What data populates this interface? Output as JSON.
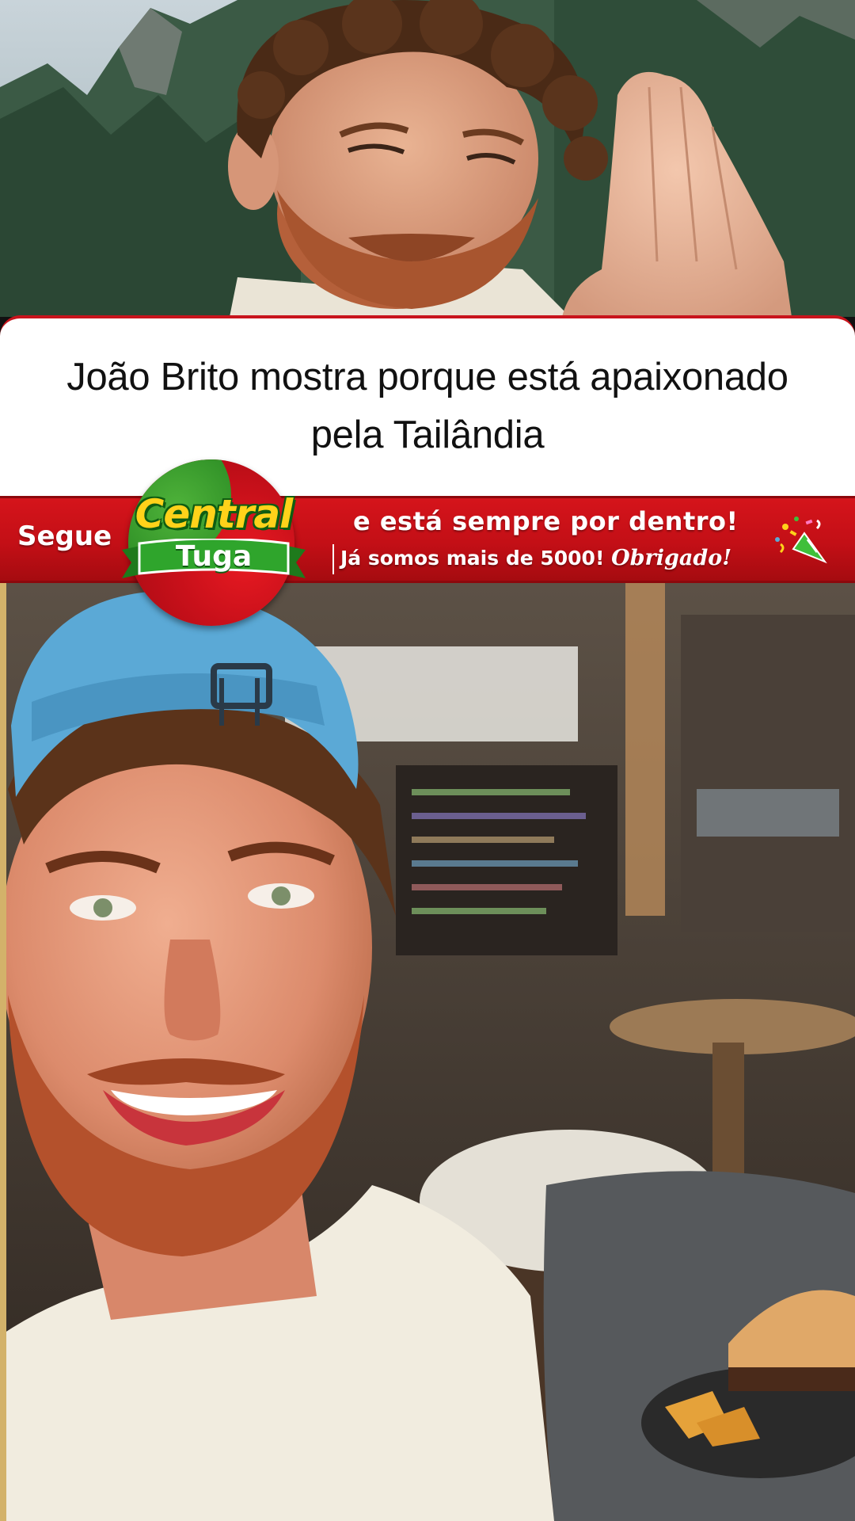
{
  "caption": {
    "line1": "João Brito mostra porque está apaixonado",
    "line2": "pela Tailândia"
  },
  "banner": {
    "segue": "Segue",
    "line1": "e está sempre por dentro!",
    "line2": "Já somos mais de 5000!",
    "thanks": "Obrigado!",
    "background_color": "#c8141c",
    "icon": "party-popper-icon"
  },
  "logo": {
    "word1": "Central",
    "word2": "Tuga",
    "colors": [
      "#2b8b24",
      "#c8101a",
      "#ffd21a"
    ]
  },
  "photos": {
    "top": "man-praying-hands-mountains",
    "bottom": "man-smiling-cap-restaurant-burger"
  }
}
